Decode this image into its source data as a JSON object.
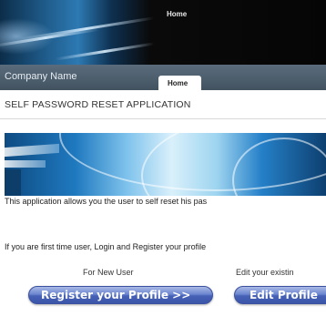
{
  "header": {
    "home_label": "Home"
  },
  "navbar": {
    "company_name": "Company Name",
    "tabs": [
      {
        "label": "Home",
        "active": true
      }
    ]
  },
  "page": {
    "title": "SELF PASSWORD RESET APPLICATION",
    "intro_text": "This application allows you the user to self reset his pas",
    "instruction_text": "If you are first time user, Login and Register your profile"
  },
  "actions": {
    "new_user_label": "For New User",
    "existing_user_label": "Edit your existin",
    "register_button": "Register your Profile >>",
    "edit_button": "Edit Profile"
  },
  "colors": {
    "navbar": "#4d5e6e",
    "button": "#4d68bb",
    "header_dark": "#050505"
  }
}
